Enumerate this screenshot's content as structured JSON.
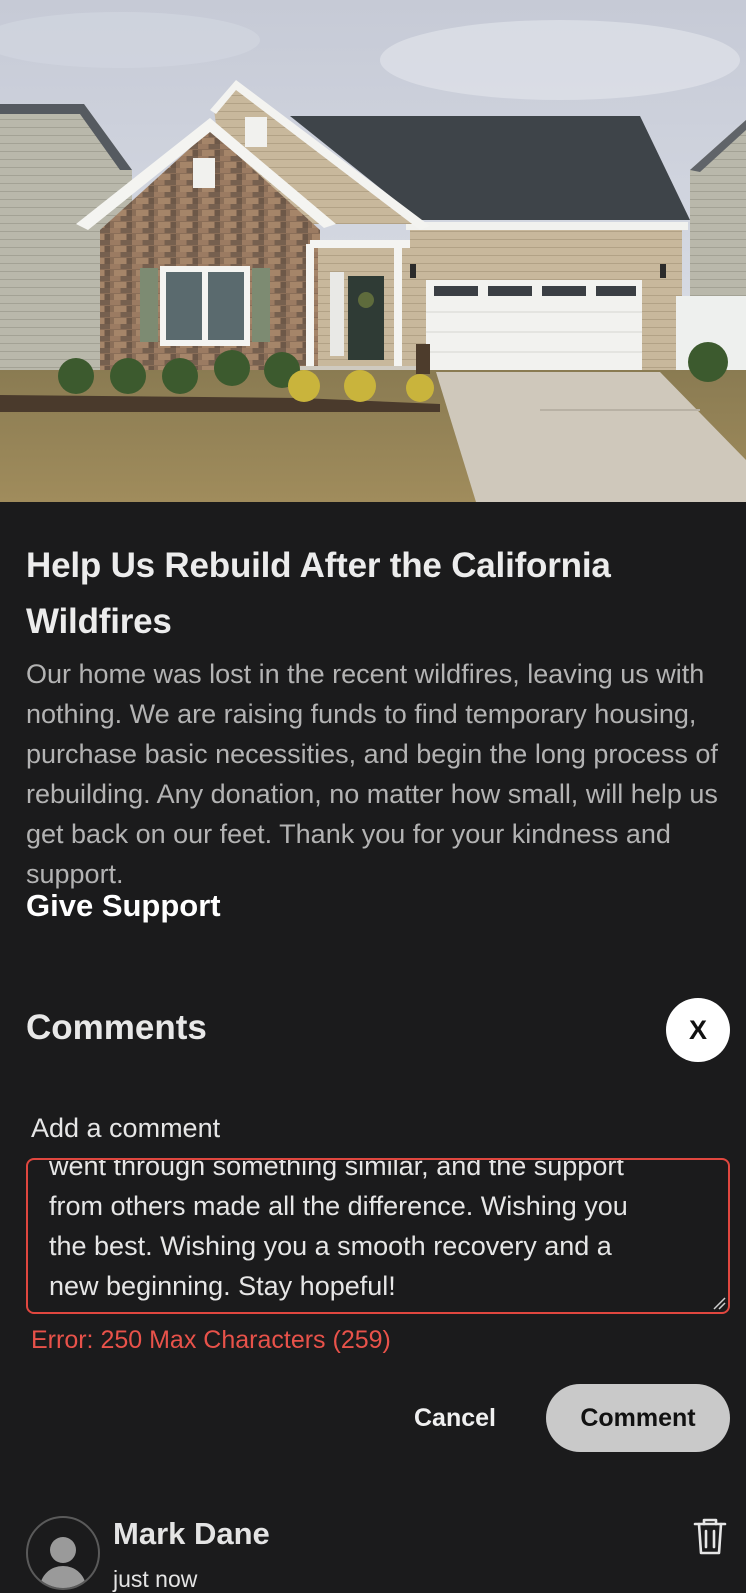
{
  "campaign": {
    "image_alt": "Front view of a suburban house with stone facade and two-car garage",
    "title": "Help Us Rebuild After the California Wildfires",
    "description": "Our home was lost in the recent wildfires, leaving us with nothing. We are raising funds to find temporary housing, purchase basic necessities, and begin the long process of rebuilding. Any donation, no matter how small, will help us get back on our feet. Thank you for your kindness and support.",
    "support_link": "Give Support"
  },
  "comments": {
    "heading": "Comments",
    "close_label": "X",
    "form": {
      "label": "Add a comment",
      "value_visible_lines": [
        "went through something similar, and the support",
        "from others made all the difference. Wishing you",
        "the best. Wishing you a smooth recovery and a",
        "new beginning. Stay hopeful!"
      ],
      "error": "Error: 250 Max Characters (259)",
      "cancel_label": "Cancel",
      "submit_label": "Comment"
    },
    "items": [
      {
        "author": "Mark Dane",
        "time": "just now",
        "avatar_icon": "person-icon",
        "delete_icon": "trash-icon"
      }
    ]
  },
  "colors": {
    "background": "#1b1b1c",
    "error": "#e0473f",
    "primary_button": "#c9c9c9"
  }
}
